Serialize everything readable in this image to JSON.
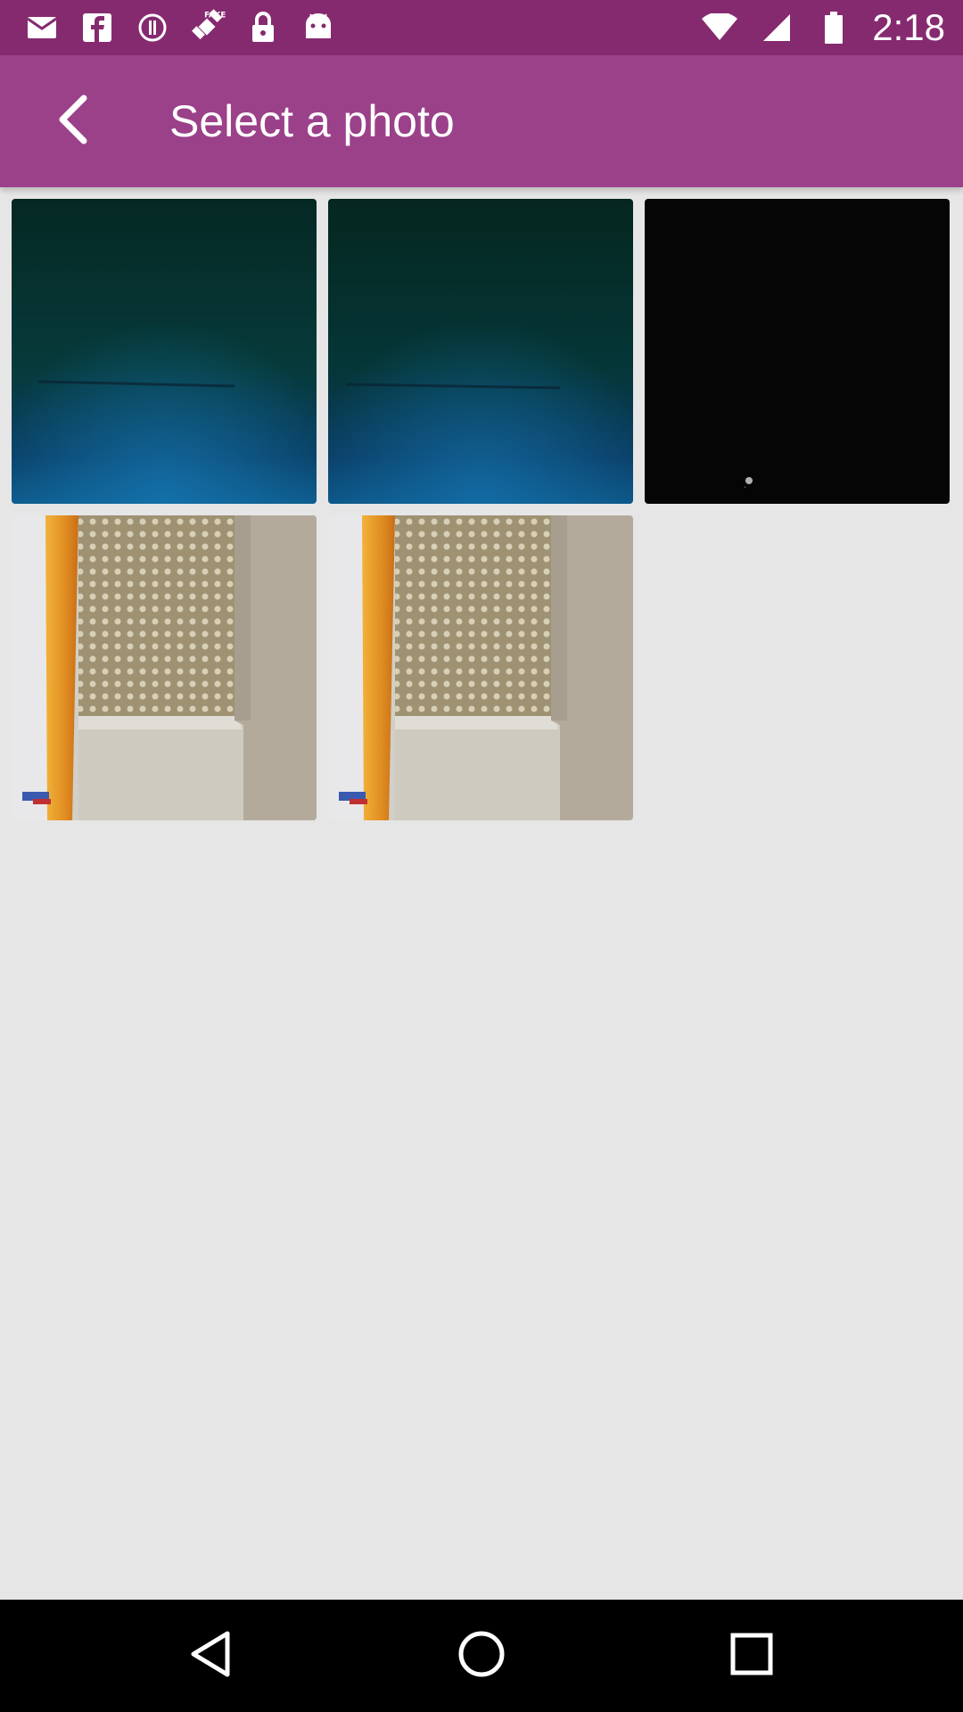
{
  "status_bar": {
    "time": "2:18",
    "left_icons": [
      "mail-icon",
      "facebook-icon",
      "info-circle-icon",
      "fake-gps-satellite-icon",
      "lock-icon",
      "android-icon"
    ],
    "right_icons": [
      "wifi-icon",
      "signal-icon",
      "battery-icon"
    ]
  },
  "app_bar": {
    "title": "Select a photo",
    "back_icon": "back-arrow-icon",
    "background": "#9b418a",
    "status_background": "#862a70"
  },
  "photos": [
    {
      "name": "photo-1",
      "subject": "dark-green-blue"
    },
    {
      "name": "photo-2",
      "subject": "dark-green-blue"
    },
    {
      "name": "photo-3",
      "subject": "black"
    },
    {
      "name": "photo-4",
      "subject": "hallway"
    },
    {
      "name": "photo-5",
      "subject": "hallway"
    }
  ],
  "nav_bar": {
    "buttons": [
      "back-triangle-icon",
      "home-circle-icon",
      "recents-square-icon"
    ]
  }
}
